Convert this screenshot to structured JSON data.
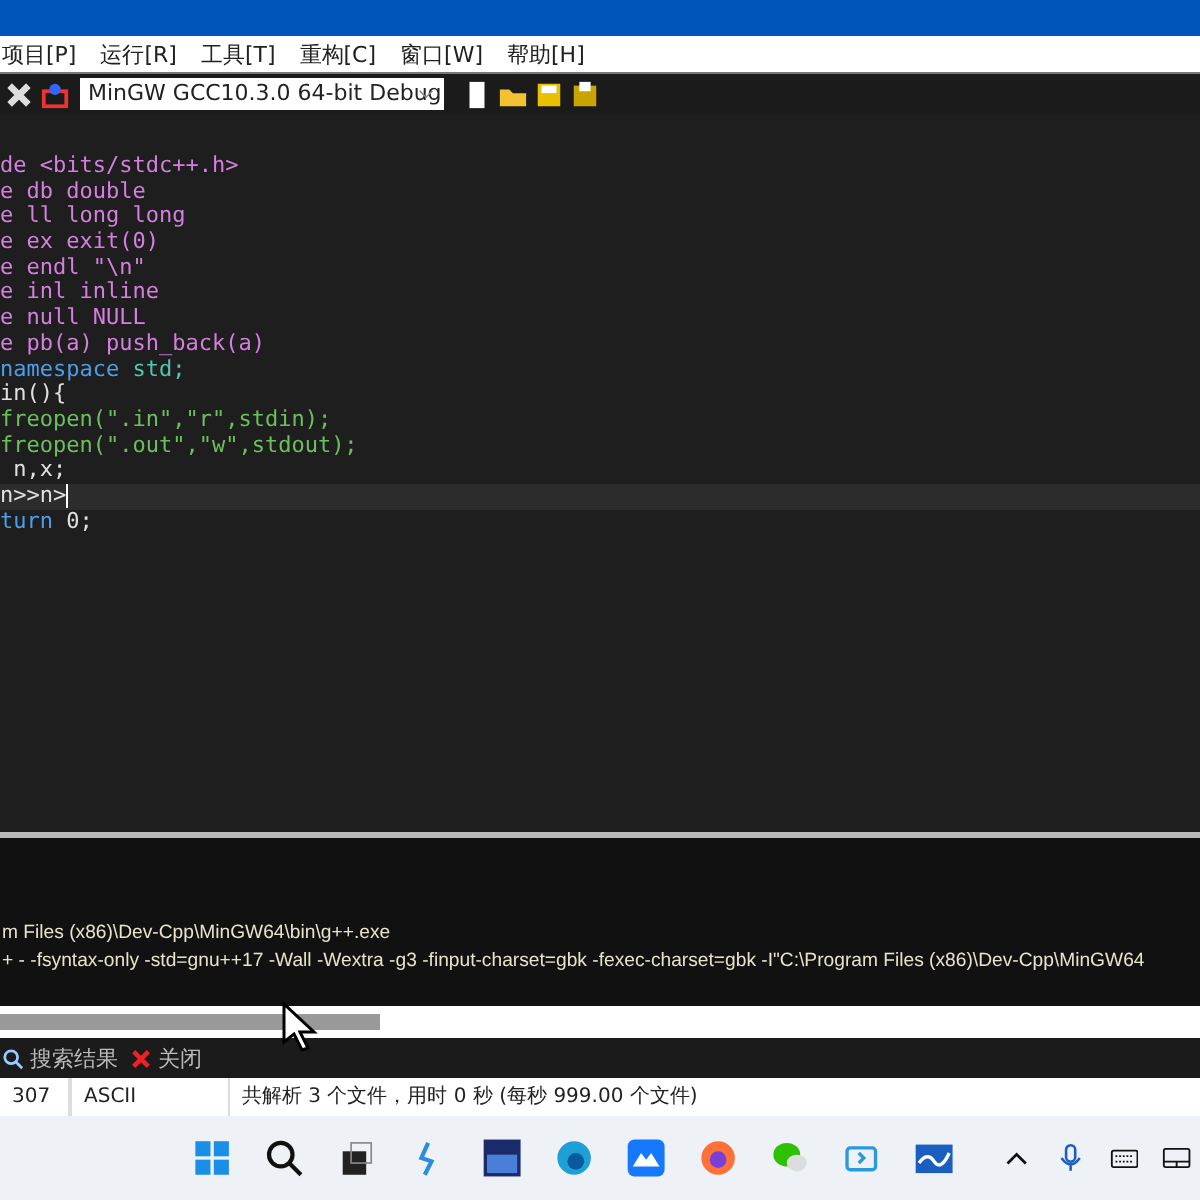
{
  "menu": [
    {
      "label": "项目[P]"
    },
    {
      "label": "运行[R]"
    },
    {
      "label": "工具[T]"
    },
    {
      "label": "重构[C]"
    },
    {
      "label": "窗口[W]"
    },
    {
      "label": "帮助[H]"
    }
  ],
  "toolbar": {
    "compiler": "MinGW GCC10.3.0 64-bit Debug"
  },
  "editor": {
    "lines": [
      {
        "current": false,
        "tokens": [
          {
            "kind": "pre",
            "text": "de <bits/stdc++.h>"
          }
        ]
      },
      {
        "current": false,
        "tokens": [
          {
            "kind": "pre",
            "text": "e db double"
          }
        ]
      },
      {
        "current": false,
        "tokens": [
          {
            "kind": "pre",
            "text": "e ll long long"
          }
        ]
      },
      {
        "current": false,
        "tokens": [
          {
            "kind": "pre",
            "text": "e ex exit(0)"
          }
        ]
      },
      {
        "current": false,
        "tokens": [
          {
            "kind": "pre",
            "text": "e endl \"\\n\""
          }
        ]
      },
      {
        "current": false,
        "tokens": [
          {
            "kind": "pre",
            "text": "e inl inline"
          }
        ]
      },
      {
        "current": false,
        "tokens": [
          {
            "kind": "pre",
            "text": "e null NULL"
          }
        ]
      },
      {
        "current": false,
        "tokens": [
          {
            "kind": "pre",
            "text": "e pb(a) push_back(a)"
          }
        ]
      },
      {
        "current": false,
        "tokens": [
          {
            "kind": "kw",
            "text": "namespace"
          },
          {
            "kind": "id",
            "text": " std;"
          }
        ]
      },
      {
        "current": false,
        "tokens": [
          {
            "kind": "plain",
            "text": "in(){"
          }
        ]
      },
      {
        "current": false,
        "tokens": [
          {
            "kind": "comment",
            "text": "freopen(\".in\",\"r\",stdin);"
          }
        ]
      },
      {
        "current": false,
        "tokens": [
          {
            "kind": "comment",
            "text": "freopen(\".out\",\"w\",stdout);"
          }
        ]
      },
      {
        "current": false,
        "tokens": [
          {
            "kind": "plain",
            "text": " n,x;"
          }
        ]
      },
      {
        "current": true,
        "tokens": [
          {
            "kind": "plain",
            "text": "n>>n>"
          }
        ]
      },
      {
        "current": false,
        "tokens": [
          {
            "kind": "kw",
            "text": "turn"
          },
          {
            "kind": "plain",
            "text": " 0;"
          }
        ]
      }
    ]
  },
  "output": {
    "lines": [
      "m Files (x86)\\Dev-Cpp\\MinGW64\\bin\\g++.exe",
      "+ - -fsyntax-only -std=gnu++17 -Wall -Wextra -g3 -finput-charset=gbk -fexec-charset=gbk -I\"C:\\Program Files (x86)\\Dev-Cpp\\MinGW64"
    ]
  },
  "bottom_tabs": [
    {
      "label": "搜索结果",
      "kind": "search"
    },
    {
      "label": "关闭",
      "kind": "close"
    }
  ],
  "status_bar": [
    "307",
    "ASCII",
    "共解析 3 个文件，用时 0 秒 (每秒 999.00 个文件)"
  ]
}
